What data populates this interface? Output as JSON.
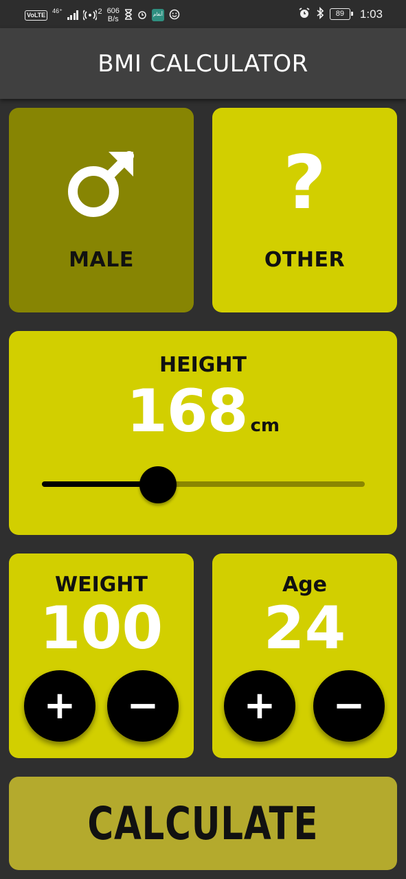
{
  "status_bar": {
    "volte": "VoLTE",
    "network": "46⁺",
    "hotspot_count": "2",
    "speed_value": "606",
    "speed_unit": "B/s",
    "app_icon_text": "أنغام",
    "battery": "89",
    "time": "1:03",
    "icons": [
      "volte-icon",
      "signal-icon",
      "hotspot-icon",
      "hourglass-icon",
      "alarm-icon",
      "app-icon",
      "emoji-icon",
      "alarm-clock-icon",
      "bluetooth-icon",
      "battery-icon"
    ]
  },
  "app_bar": {
    "title": "BMI CALCULATOR"
  },
  "gender": {
    "male": {
      "label": "MALE",
      "icon": "male-icon",
      "selected": true
    },
    "other": {
      "label": "OTHER",
      "icon": "question-mark-icon",
      "glyph": "?",
      "selected": false
    }
  },
  "height": {
    "label": "HEIGHT",
    "value": "168",
    "unit": "cm",
    "slider_fraction": 0.36
  },
  "weight": {
    "label": "WEIGHT",
    "value": "100",
    "plus": "+",
    "minus": "−"
  },
  "age": {
    "label": "Age",
    "value": "24",
    "plus": "+",
    "minus": "−"
  },
  "calculate": {
    "label": "CALCULATE"
  },
  "colors": {
    "background": "#2f2f2f",
    "app_bar": "#404040",
    "card_active": "#d2cf00",
    "card_selected": "#878503",
    "calculate": "#b4aa2d",
    "slider_inactive": "#8a8600"
  }
}
